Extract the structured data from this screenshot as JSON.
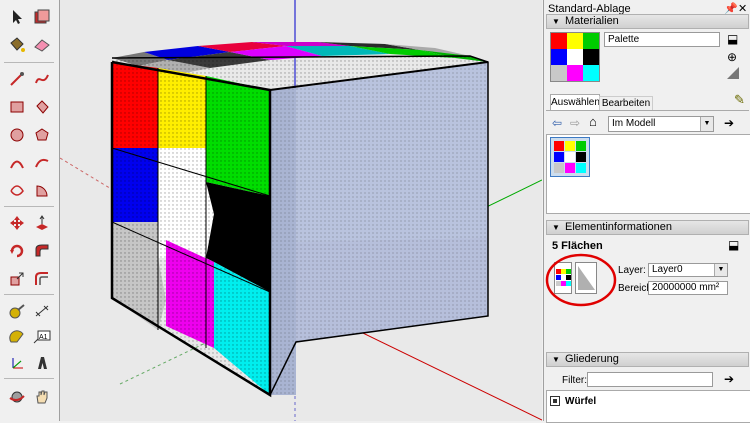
{
  "tray": {
    "title": "Standard-Ablage",
    "pin_icon": "pin-icon",
    "close_icon": "close-icon"
  },
  "materials": {
    "header": "Materialien",
    "name_value": "Palette",
    "tabs": [
      "Auswählen",
      "Bearbeiten"
    ],
    "collection": "Im Modell",
    "palette_colors": [
      "#ff0000",
      "#ffff00",
      "#00cc00",
      "#0000ff",
      "#ffffff",
      "#000000",
      "#c8c8c8",
      "#ff00ff",
      "#00ffff"
    ]
  },
  "entity_info": {
    "header": "Elementinformationen",
    "summary": "5 Flächen",
    "layer_label": "Layer:",
    "layer_value": "Layer0",
    "area_label": "Bereich:",
    "area_value": "20000000 mm²"
  },
  "outliner": {
    "header": "Gliederung",
    "filter_label": "Filter:",
    "filter_value": "",
    "item": "Würfel"
  },
  "colors": {
    "highlight_circle": "#e00000",
    "cube_base": "#b9c3de",
    "axis_red": "#cc0000",
    "axis_green": "#00aa00",
    "axis_blue": "#0000cc"
  }
}
